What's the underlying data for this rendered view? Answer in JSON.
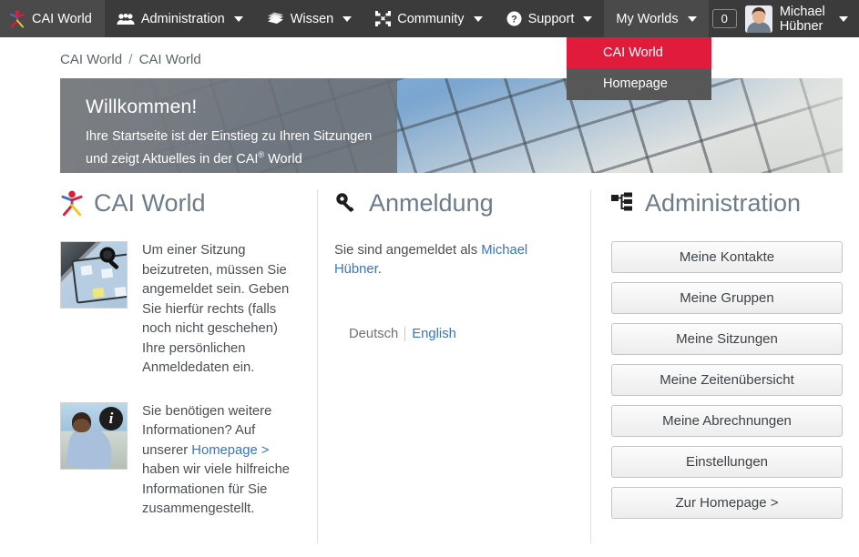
{
  "navbar": {
    "brand": {
      "label": "CAI World",
      "icon": "cai-figure-icon"
    },
    "items": [
      {
        "label": "Administration",
        "icon": "users-icon"
      },
      {
        "label": "Wissen",
        "icon": "books-icon"
      },
      {
        "label": "Community",
        "icon": "compress-arrows-icon"
      },
      {
        "label": "Support",
        "icon": "question-circle-icon"
      }
    ],
    "my_worlds": {
      "label": "My Worlds"
    },
    "badge_count": "0",
    "user": {
      "name": "Michael Hübner"
    },
    "dropdown": {
      "items": [
        {
          "label": "CAI World",
          "selected": true
        },
        {
          "label": "Homepage",
          "selected": false
        }
      ]
    }
  },
  "breadcrumb": {
    "first": "CAI World",
    "separator": "/",
    "second": "CAI World"
  },
  "banner": {
    "title": "Willkommen!",
    "line1": "Ihre Startseite ist der Einstieg zu Ihren Sitzungen",
    "line2_before": "und zeigt Aktuelles in der CAI",
    "line2_sup": "®",
    "line2_after": " World"
  },
  "columns": {
    "left": {
      "heading": "CAI World",
      "heading_icon": "cai-figure-icon",
      "blocks": [
        {
          "thumb": "tablet-search-thumbnail",
          "badge_icon": "magnifier-icon",
          "text": "Um einer Sitzung beizutreten, müssen Sie angemeldet sein. Geben Sie hierfür rechts (falls noch nicht geschehen) Ihre persönlichen Anmeldedaten ein."
        },
        {
          "thumb": "man-laptop-thumbnail",
          "badge_icon": "info-icon",
          "text_part1": "Sie benötigen weitere Informationen? Auf unserer ",
          "link": "Homepage >",
          "text_part2": " haben wir viele hilfreiche Informationen für Sie zusammengestellt."
        }
      ]
    },
    "middle": {
      "heading": "Anmeldung",
      "heading_icon": "key-icon",
      "status_prefix": "Sie sind angemeldet als ",
      "status_user": "Michael Hübner",
      "status_suffix": ".",
      "lang_current": "Deutsch",
      "lang_other": "English"
    },
    "right": {
      "heading": "Administration",
      "heading_icon": "sitemap-icon",
      "buttons": [
        "Meine Kontakte",
        "Meine Gruppen",
        "Meine Sitzungen",
        "Meine Zeitenübersicht",
        "Meine Abrechnungen",
        "Einstellungen",
        "Zur Homepage >"
      ]
    }
  },
  "colors": {
    "navbar_bg": "#3b3b3b",
    "navbar_active": "#4a4a4a",
    "dropdown_bg": "#575757",
    "accent_red": "#e01b3c",
    "heading_grey": "#6d7c88",
    "link_blue": "#3a73c4",
    "banner_overlay": "#6c7074"
  }
}
